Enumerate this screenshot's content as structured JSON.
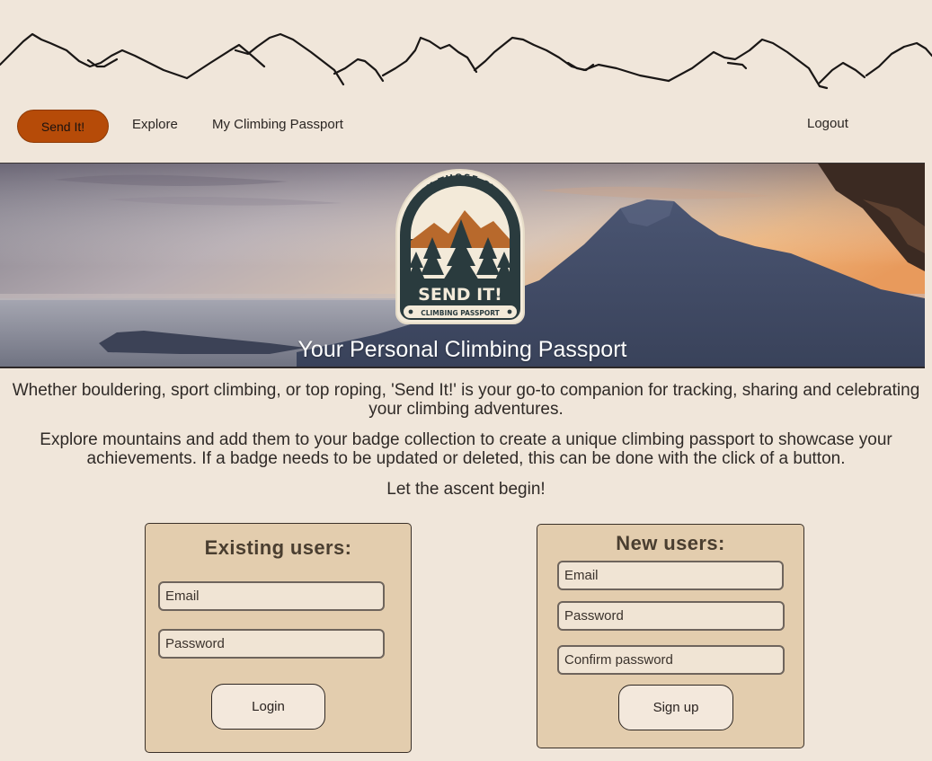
{
  "nav": {
    "brand_label": "Send It!",
    "explore_label": "Explore",
    "passport_label": "My Climbing Passport",
    "logout_label": "Logout"
  },
  "hero": {
    "badge_top_text": "CRUSH THOSE CLIMBS",
    "badge_main_text": "SEND IT!",
    "badge_bottom_text": "CLIMBING PASSPORT",
    "title": "Your Personal Climbing Passport"
  },
  "intro": {
    "paragraph_1": "Whether bouldering, sport climbing, or top roping, 'Send It!' is your go-to companion for tracking, sharing and celebrating your climbing adventures.",
    "paragraph_2": "Explore mountains and add them to your badge collection to create a unique climbing passport to showcase your achievements. If a badge needs to be updated or deleted, this can be done with the click of a button.",
    "paragraph_3": "Let the ascent begin!"
  },
  "existing_users": {
    "title": "Existing users:",
    "email_placeholder": "Email",
    "password_placeholder": "Password",
    "login_label": "Login"
  },
  "new_users": {
    "title": "New users:",
    "email_placeholder": "Email",
    "password_placeholder": "Password",
    "confirm_placeholder": "Confirm password",
    "signup_label": "Sign up"
  },
  "colors": {
    "background": "#f0e6da",
    "brand_button": "#b64b08",
    "card": "#e3cdae",
    "badge_dark": "#2a3b3e",
    "badge_cream": "#f3ead9",
    "badge_orange": "#b8692c"
  }
}
